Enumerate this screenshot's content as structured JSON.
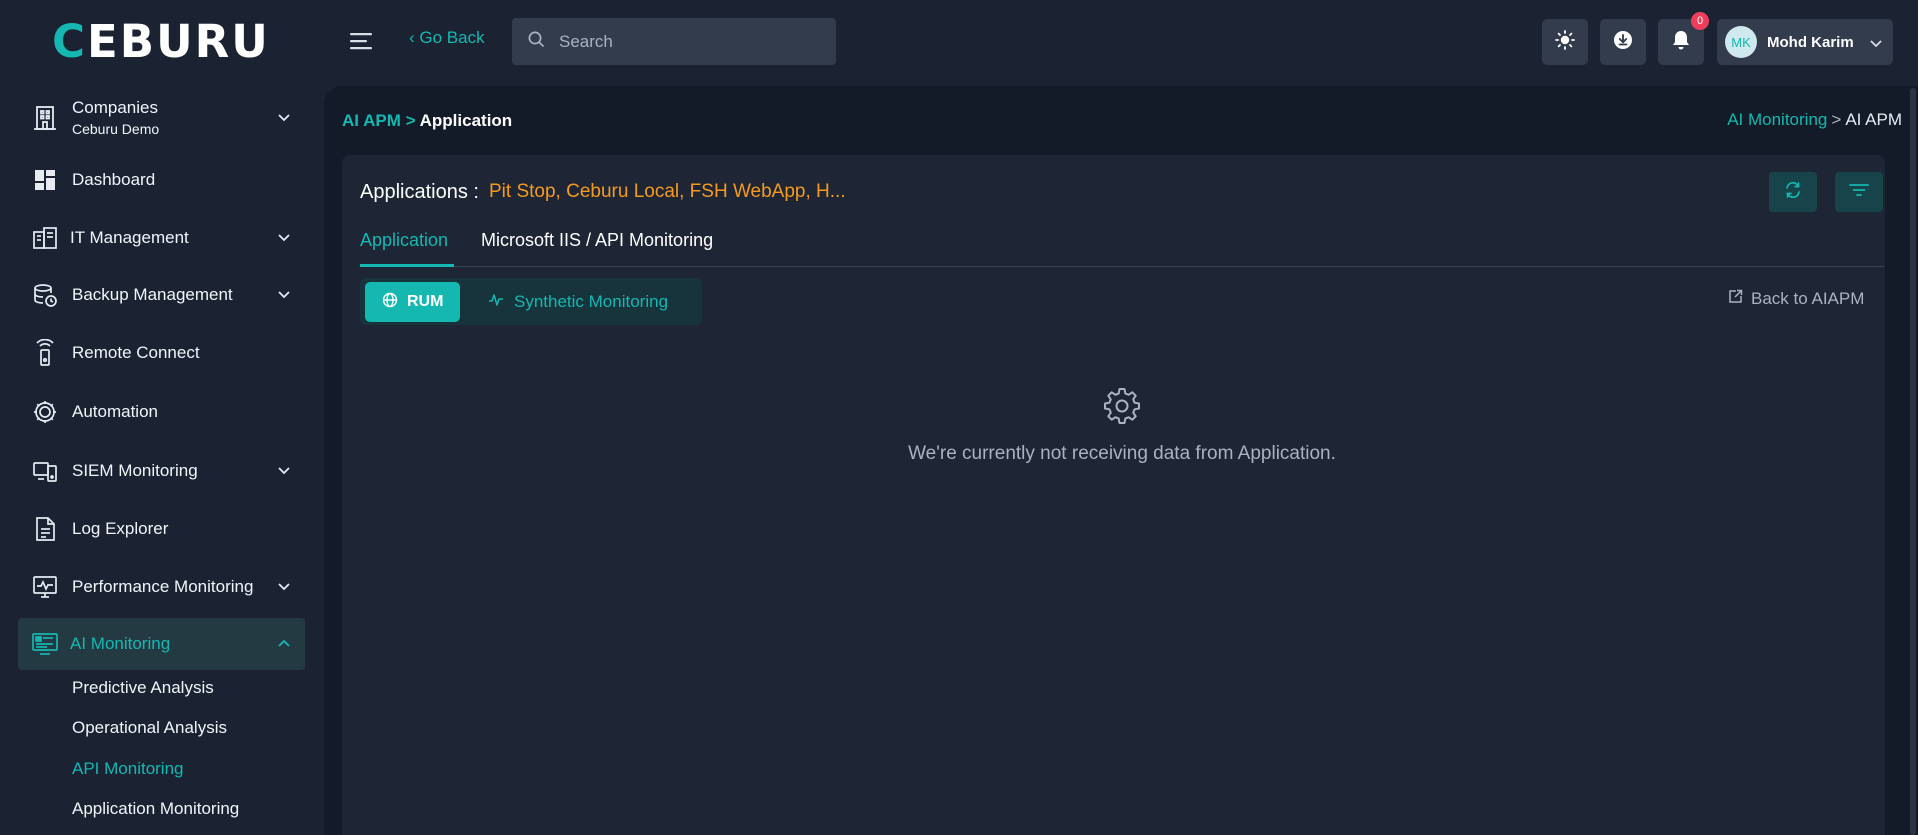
{
  "brand": {
    "logo_first": "C",
    "logo_rest": "EBURU"
  },
  "header": {
    "go_back": "‹ Go Back",
    "search_placeholder": "Search",
    "notifications_count": "0",
    "user": {
      "initials": "MK",
      "name": "Mohd Karim"
    }
  },
  "sidebar": {
    "company": {
      "label": "Companies",
      "sub": "Ceburu Demo"
    },
    "items": [
      {
        "label": "Dashboard",
        "icon": "dashboard-icon"
      },
      {
        "label": "IT Management",
        "icon": "it-management-icon"
      },
      {
        "label": "Backup Management",
        "icon": "backup-icon"
      },
      {
        "label": "Remote Connect",
        "icon": "remote-connect-icon"
      },
      {
        "label": "Automation",
        "icon": "automation-icon"
      },
      {
        "label": "SIEM Monitoring",
        "icon": "siem-icon"
      },
      {
        "label": "Log Explorer",
        "icon": "log-file-icon"
      },
      {
        "label": "Performance Monitoring",
        "icon": "performance-icon"
      },
      {
        "label": "AI Monitoring",
        "icon": "ai-monitor-icon"
      }
    ],
    "ai_sub": [
      {
        "label": "Predictive Analysis"
      },
      {
        "label": "Operational Analysis"
      },
      {
        "label": "API Monitoring"
      },
      {
        "label": "Application Monitoring"
      }
    ]
  },
  "breadcrumb": {
    "left_link": "AI APM",
    "left_sep": ">",
    "left_current": "Application",
    "right_link": "AI Monitoring",
    "right_sep": ">",
    "right_current": "AI APM"
  },
  "content": {
    "apps_label": "Applications :",
    "apps_value": "Pit Stop, Ceburu Local, FSH WebApp, H...",
    "tabs": [
      {
        "label": "Application"
      },
      {
        "label": "Microsoft IIS / API Monitoring"
      }
    ],
    "segments": {
      "rum": "RUM",
      "synthetic": "Synthetic Monitoring"
    },
    "back_link": "Back to AIAPM",
    "empty_message": "We're currently not receiving data from Application."
  },
  "colors": {
    "accent": "#14b8b0",
    "orange": "#f59a1f",
    "badge": "#ef3e5c"
  }
}
